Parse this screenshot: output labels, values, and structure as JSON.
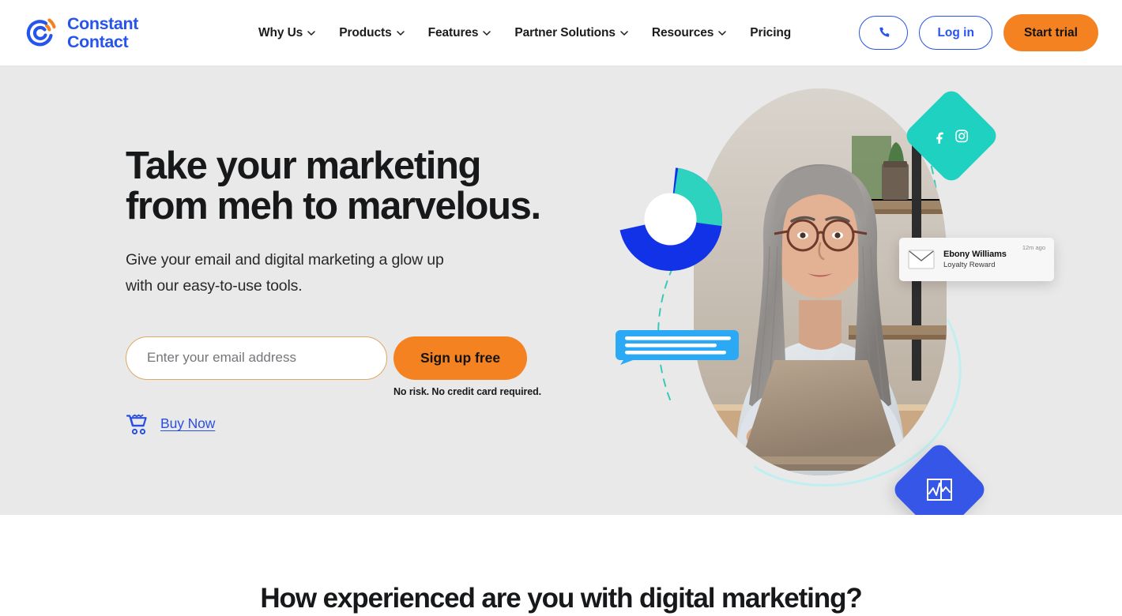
{
  "brand": {
    "logo_name": "Constant\nContact",
    "logo_icon": "constant-contact-logo-icon",
    "blue": "#2754eb",
    "orange": "#f58220",
    "teal": "#1fd1c0",
    "royal_blue": "#3556e6",
    "hero_bg": "#e9e9e9"
  },
  "header": {
    "nav": [
      {
        "label": "Why Us",
        "has_dropdown": true
      },
      {
        "label": "Products",
        "has_dropdown": true
      },
      {
        "label": "Features",
        "has_dropdown": true
      },
      {
        "label": "Partner Solutions",
        "has_dropdown": true
      },
      {
        "label": "Resources",
        "has_dropdown": true
      },
      {
        "label": "Pricing",
        "has_dropdown": false
      }
    ],
    "phone_icon": "phone-icon",
    "login_label": "Log in",
    "trial_label": "Start trial"
  },
  "hero": {
    "title": "Take your marketing\nfrom meh to marvelous.",
    "subtitle": "Give your email and digital marketing a glow up\nwith our easy-to-use tools.",
    "email_placeholder": "Enter your email address",
    "email_value": "",
    "signup_label": "Sign up free",
    "disclaimer": "No risk. No credit card required.",
    "buy_now_label": "Buy Now",
    "cart_icon": "shopping-cart-icon",
    "art": {
      "photo_alt": "woman-at-laptop-photo",
      "donut_icon": "donut-chart-icon",
      "chat_icon": "chat-bubble-icon",
      "social_icons": [
        "facebook-icon",
        "instagram-icon"
      ],
      "analytics_icon": "analytics-chart-icon",
      "notification": {
        "envelope_icon": "envelope-icon",
        "name": "Ebony Williams",
        "subject": "Loyalty Reward",
        "time": "12m ago"
      }
    }
  },
  "experience_section": {
    "title": "How experienced are you with digital marketing?"
  }
}
